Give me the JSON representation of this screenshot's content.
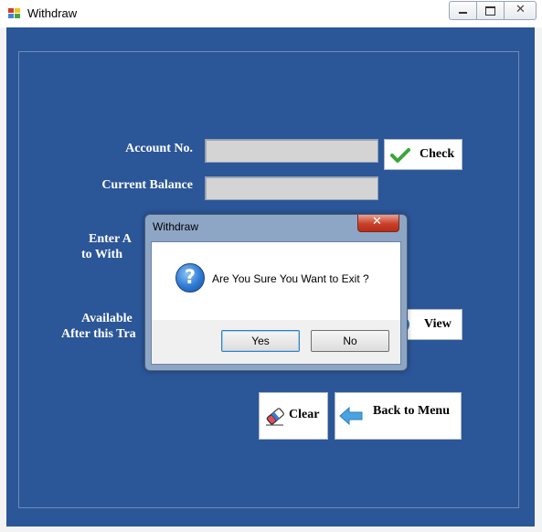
{
  "window": {
    "title": "Withdraw"
  },
  "form": {
    "account_no_label": "Account No.",
    "current_balance_label": "Current Balance",
    "enter_amount_label_line1": "Enter A",
    "enter_amount_label_line2": "to With",
    "available_label_line1": "Available",
    "available_label_line2": "After this Tra",
    "account_no_value": "",
    "current_balance_value": ""
  },
  "buttons": {
    "check": "Check",
    "view": "View",
    "clear": "Clear",
    "back_to_menu": "Back to Menu"
  },
  "dialog": {
    "title": "Withdraw",
    "message": "Are You Sure You Want to Exit ?",
    "yes": "Yes",
    "no": "No"
  },
  "colors": {
    "client_background": "#2b5698",
    "field_background": "#d4d4d4",
    "check_green": "#3aa53a",
    "arrow_blue": "#4aa3e0"
  }
}
